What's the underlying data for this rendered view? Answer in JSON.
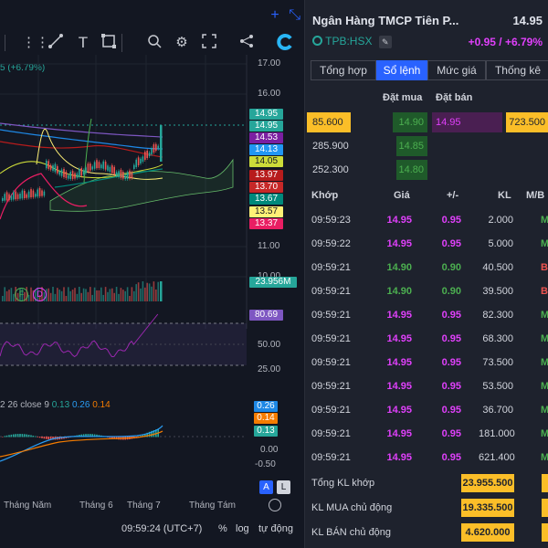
{
  "toolbar": {
    "icons": [
      "drag-handle-icon",
      "trendline-icon",
      "text-icon",
      "rectangle-icon",
      "zoom-icon",
      "settings-icon",
      "fullscreen-icon",
      "share-icon",
      "snapshot-icon"
    ],
    "add_icon": "+",
    "collapse_icon": "⤡"
  },
  "chart": {
    "change_pct_label": "5 (+6.79%)",
    "price_axis": [
      "17.00",
      "16.00",
      "11.00",
      "10.00",
      "50.00",
      "25.00",
      "0.00",
      "-0.50"
    ],
    "price_tags": [
      {
        "label": "14.95",
        "color": "#26a69a"
      },
      {
        "label": "14.95",
        "color": "#26a69a"
      },
      {
        "label": "14.53",
        "color": "#7b1fa2"
      },
      {
        "label": "14.13",
        "color": "#2196f3"
      },
      {
        "label": "14.05",
        "color": "#cddc39"
      },
      {
        "label": "13.97",
        "color": "#b71c1c"
      },
      {
        "label": "13.70",
        "color": "#c62828"
      },
      {
        "label": "13.67",
        "color": "#00897b"
      },
      {
        "label": "13.57",
        "color": "#fff176"
      },
      {
        "label": "13.37",
        "color": "#e91e63"
      }
    ],
    "volume_tag": "23.956M",
    "rsi_tag": "80.69",
    "macd_tags": [
      {
        "label": "0.26",
        "color": "#1e88e5"
      },
      {
        "label": "0.14",
        "color": "#f57c00"
      },
      {
        "label": "0.13",
        "color": "#26a69a"
      }
    ],
    "macd_legend": {
      "prefix": "2 26 close 9",
      "v1": "0.13",
      "v2": "0.26",
      "v3": "0.14"
    },
    "fd_icons": [
      "F",
      "D"
    ],
    "months": [
      "Tháng Năm",
      "Tháng 6",
      "Tháng 7",
      "Tháng Tám"
    ],
    "scale_buttons": [
      "A",
      "L"
    ],
    "time": "09:59:24 (UTC+7)",
    "pct_label": "%",
    "log_label": "log",
    "auto_label": "tự động"
  },
  "stock": {
    "name": "Ngân Hàng TMCP Tiên P...",
    "price": "14.95",
    "ticker": "TPB:HSX",
    "change": "+0.95 / +6.79%"
  },
  "tabs": [
    "Tổng hợp",
    "Sổ lệnh",
    "Mức giá",
    "Thống kê"
  ],
  "active_tab": "Sổ lệnh",
  "orderbook": {
    "bid_header": "Đặt mua",
    "ask_header": "Đặt bán",
    "rows": [
      {
        "bid_vol": "85.600",
        "bid": "14.90",
        "ask": "14.95",
        "ask_vol": "723.500"
      },
      {
        "bid_vol": "285.900",
        "bid": "14.85",
        "ask": "",
        "ask_vol": ""
      },
      {
        "bid_vol": "252.300",
        "bid": "14.80",
        "ask": "",
        "ask_vol": ""
      }
    ]
  },
  "trades": {
    "headers": [
      "Khớp",
      "Giá",
      "+/-",
      "KL",
      "M/B"
    ],
    "rows": [
      {
        "time": "09:59:23",
        "price": "14.95",
        "change": "0.95",
        "vol": "2.000",
        "side": "M",
        "color": "#e040fb",
        "side_color": "#4caf50"
      },
      {
        "time": "09:59:22",
        "price": "14.95",
        "change": "0.95",
        "vol": "5.000",
        "side": "M",
        "color": "#e040fb",
        "side_color": "#4caf50"
      },
      {
        "time": "09:59:21",
        "price": "14.90",
        "change": "0.90",
        "vol": "40.500",
        "side": "B",
        "color": "#4caf50",
        "side_color": "#ef5350"
      },
      {
        "time": "09:59:21",
        "price": "14.90",
        "change": "0.90",
        "vol": "39.500",
        "side": "B",
        "color": "#4caf50",
        "side_color": "#ef5350"
      },
      {
        "time": "09:59:21",
        "price": "14.95",
        "change": "0.95",
        "vol": "82.300",
        "side": "M",
        "color": "#e040fb",
        "side_color": "#4caf50"
      },
      {
        "time": "09:59:21",
        "price": "14.95",
        "change": "0.95",
        "vol": "68.300",
        "side": "M",
        "color": "#e040fb",
        "side_color": "#4caf50"
      },
      {
        "time": "09:59:21",
        "price": "14.95",
        "change": "0.95",
        "vol": "73.500",
        "side": "M",
        "color": "#e040fb",
        "side_color": "#4caf50"
      },
      {
        "time": "09:59:21",
        "price": "14.95",
        "change": "0.95",
        "vol": "53.500",
        "side": "M",
        "color": "#e040fb",
        "side_color": "#4caf50"
      },
      {
        "time": "09:59:21",
        "price": "14.95",
        "change": "0.95",
        "vol": "36.700",
        "side": "M",
        "color": "#e040fb",
        "side_color": "#4caf50"
      },
      {
        "time": "09:59:21",
        "price": "14.95",
        "change": "0.95",
        "vol": "181.000",
        "side": "M",
        "color": "#e040fb",
        "side_color": "#4caf50"
      },
      {
        "time": "09:59:21",
        "price": "14.95",
        "change": "0.95",
        "vol": "621.400",
        "side": "M",
        "color": "#e040fb",
        "side_color": "#4caf50"
      }
    ]
  },
  "summary": [
    {
      "label": "Tổng KL khớp",
      "value": "23.955.500"
    },
    {
      "label": "KL MUA chủ động",
      "value": "19.335.500"
    },
    {
      "label": "KL BÁN chủ động",
      "value": "4.620.000"
    }
  ]
}
